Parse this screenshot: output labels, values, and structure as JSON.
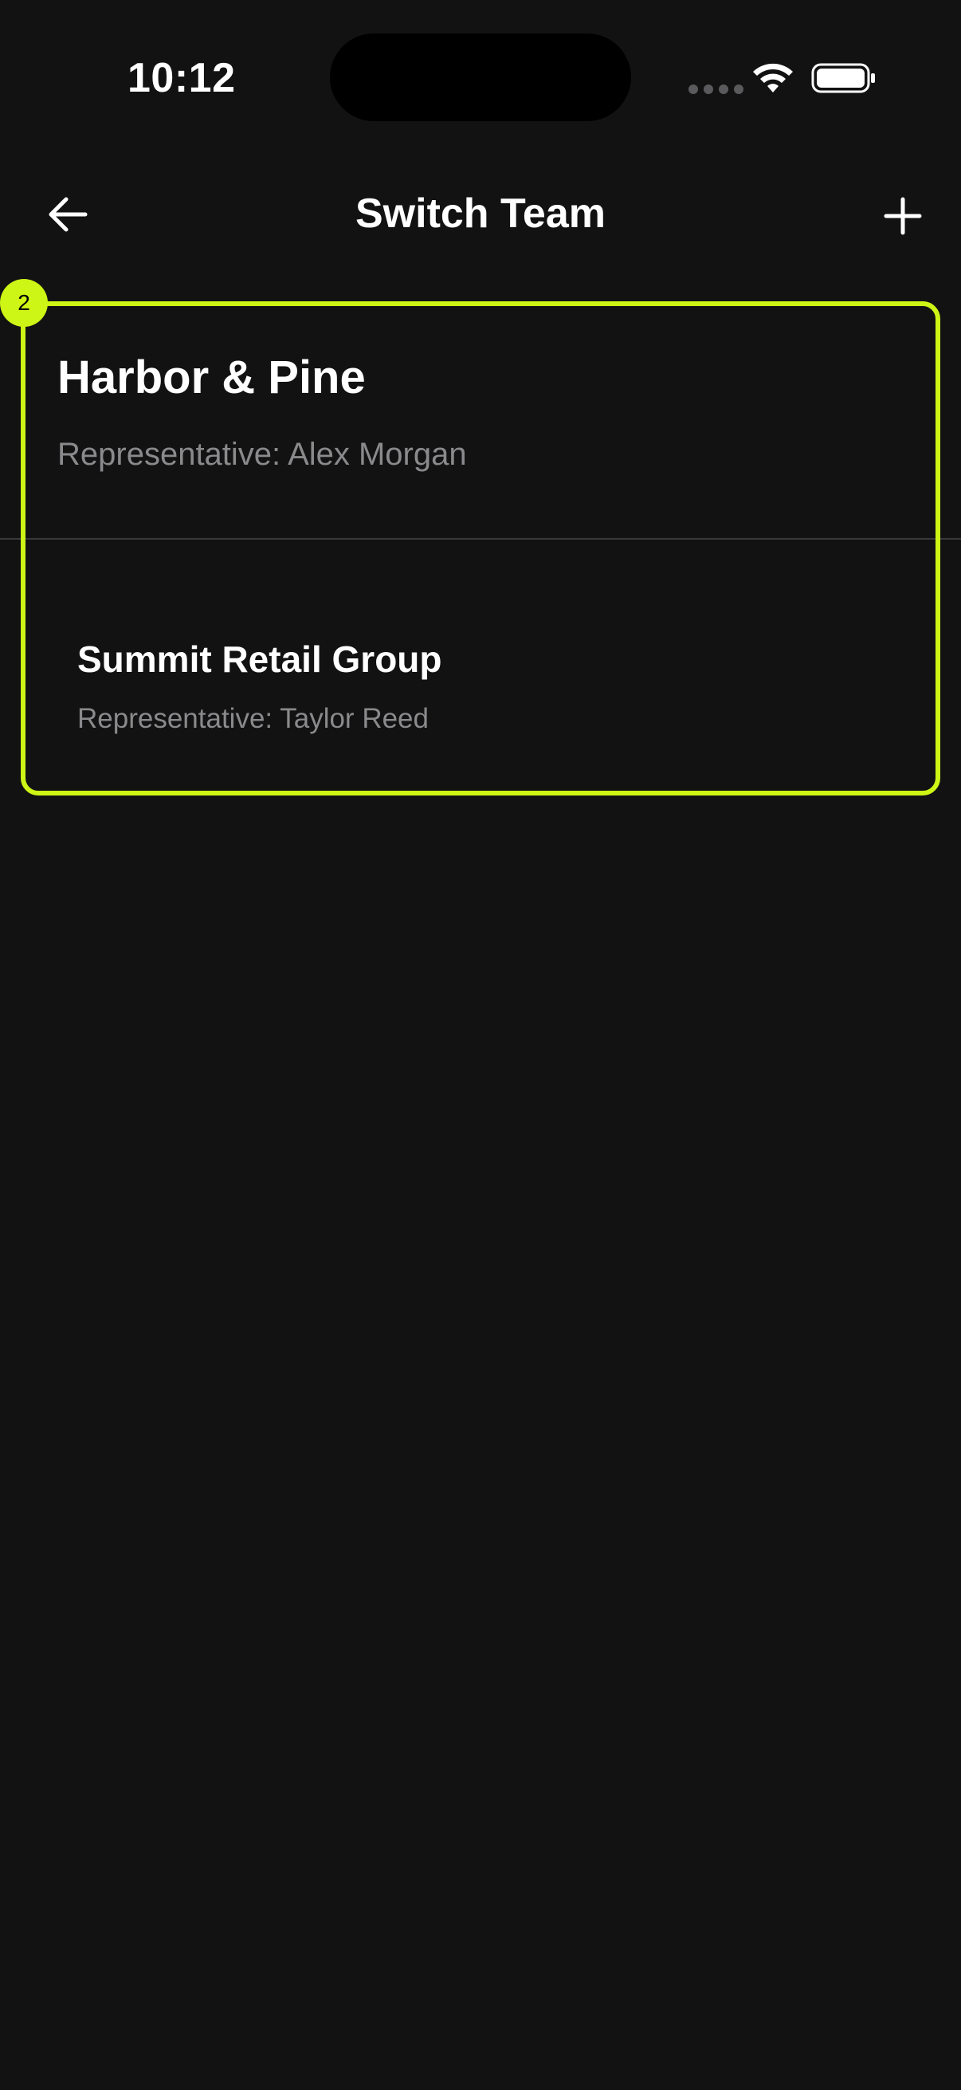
{
  "status_bar": {
    "time": "10:12",
    "icons": [
      "signal-icon",
      "wifi-icon",
      "battery-icon"
    ]
  },
  "nav": {
    "title": "Switch Team",
    "back_icon": "arrow-left-icon",
    "add_icon": "plus-icon"
  },
  "highlight": {
    "badge": "2",
    "color": "#cdf515"
  },
  "teams": [
    {
      "name": "Harbor & Pine",
      "representative": "Representative: Alex Morgan"
    },
    {
      "name": "Summit Retail Group",
      "representative": "Representative: Taylor Reed"
    }
  ],
  "colors": {
    "background": "#121213",
    "text_primary": "#ffffff",
    "text_secondary": "#8a8a8c",
    "divider": "#3a3a3c"
  }
}
